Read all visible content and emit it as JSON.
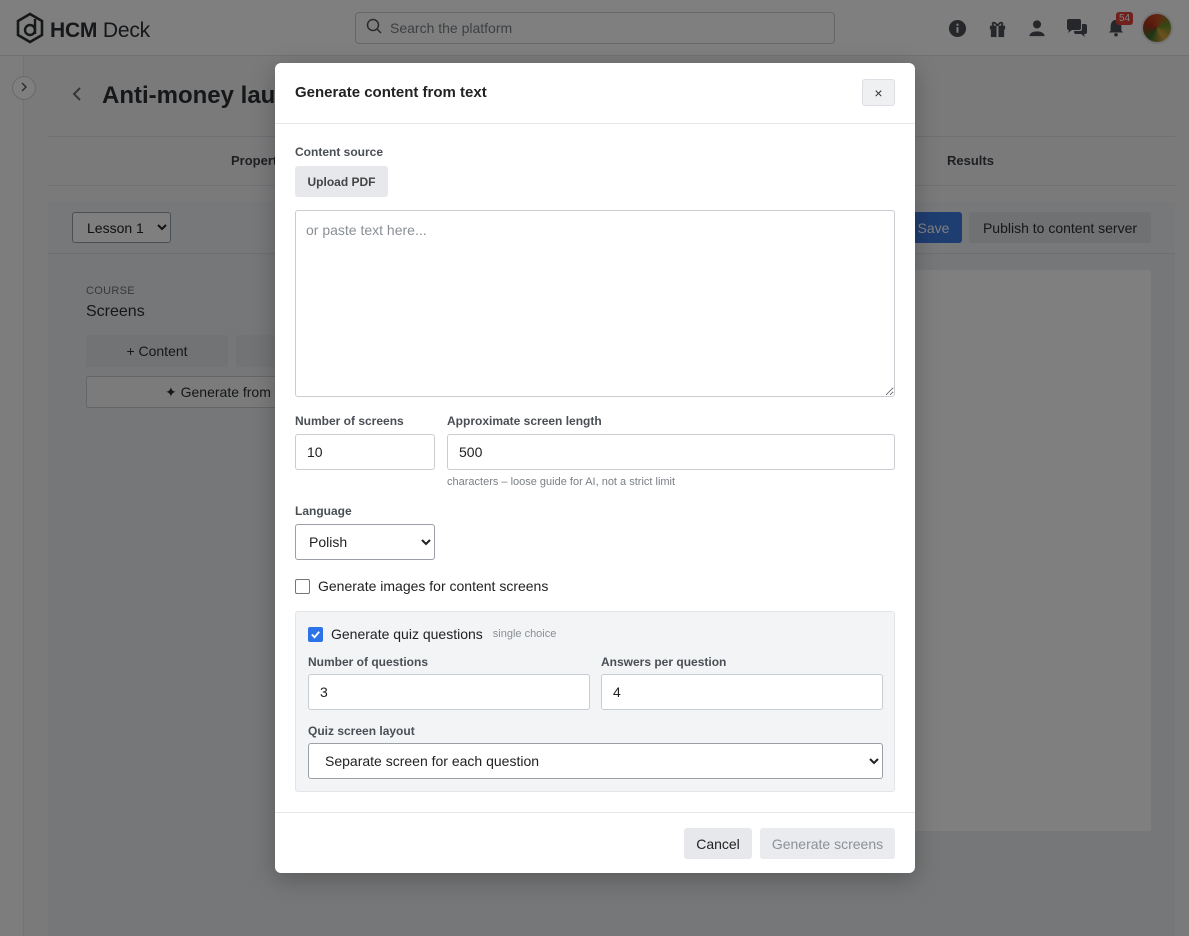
{
  "app": {
    "logo_bold": "HCM",
    "logo_light": " Deck"
  },
  "search": {
    "placeholder": "Search the platform"
  },
  "notifications": {
    "count": "54"
  },
  "page": {
    "title": "Anti-money laun",
    "tabs": [
      "Properti",
      "Results"
    ],
    "lesson": "Lesson 1",
    "save_label": "Save",
    "publish_label": "Publish to content server",
    "course_label": "COURSE",
    "screens_label": "Screens",
    "content_button": "+ Content",
    "generate_from": "✦ Generate from t"
  },
  "modal": {
    "title": "Generate content from text",
    "close_label": "×",
    "content_source_label": "Content source",
    "upload_label": "Upload PDF",
    "text_placeholder": "or paste text here...",
    "num_screens_label": "Number of screens",
    "num_screens_value": "10",
    "screen_length_label": "Approximate screen length",
    "screen_length_value": "500",
    "screen_length_hint": "characters – loose guide for AI, not a strict limit",
    "language_label": "Language",
    "language_value": "Polish",
    "images_label": "Generate images for content screens",
    "images_checked": false,
    "quiz_label": "Generate quiz questions",
    "quiz_tag": "single choice",
    "quiz_checked": true,
    "num_questions_label": "Number of questions",
    "num_questions_value": "3",
    "answers_label": "Answers per question",
    "answers_value": "4",
    "layout_label": "Quiz screen layout",
    "layout_value": "Separate screen for each question",
    "cancel_label": "Cancel",
    "generate_label": "Generate screens"
  }
}
